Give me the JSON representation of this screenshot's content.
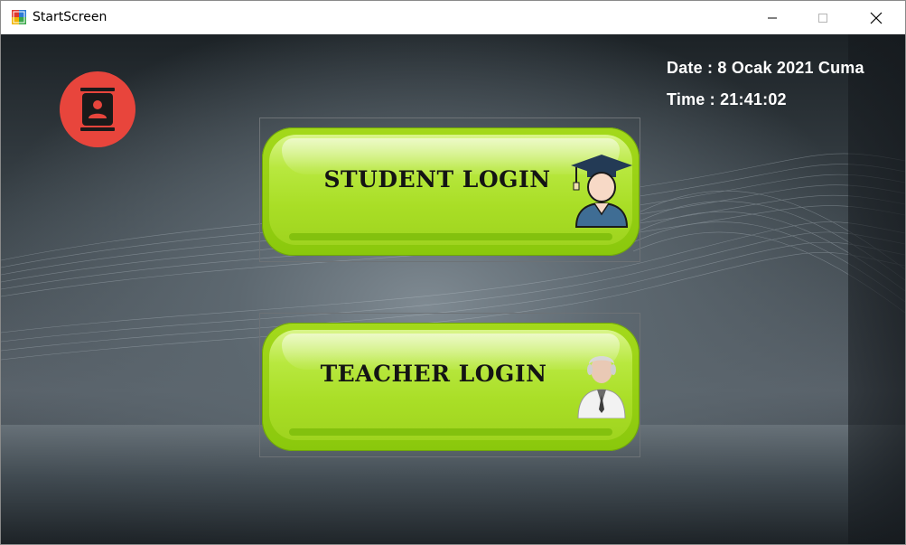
{
  "window": {
    "title": "StartScreen",
    "controls": [
      "minimize",
      "maximize",
      "close"
    ]
  },
  "header": {
    "date_label": "Date : 8 Ocak 2021 Cuma",
    "time_label": "Time : 21:41:02"
  },
  "logo": {
    "icon": "contact-book-icon",
    "color": "#e8453c"
  },
  "buttons": {
    "student": {
      "label": "STUDENT LOGIN",
      "icon": "graduate-student-icon"
    },
    "teacher": {
      "label": "TEACHER LOGIN",
      "icon": "teacher-icon"
    }
  },
  "colors": {
    "accent_green": "#a4d91b",
    "logo_red": "#e8453c",
    "background": "#4a545b"
  }
}
